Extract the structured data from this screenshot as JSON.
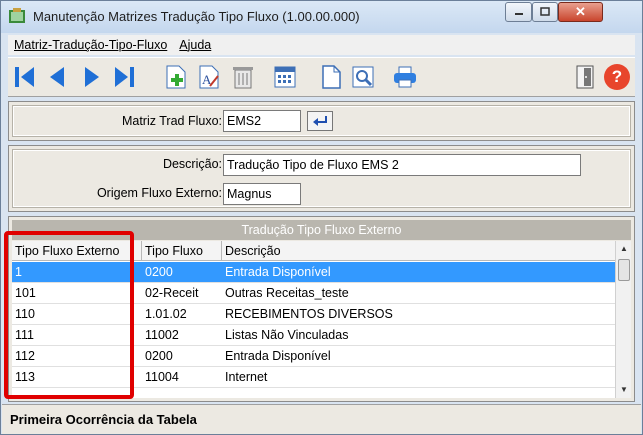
{
  "window": {
    "title": "Manutenção Matrizes Tradução Tipo Fluxo (1.00.00.000)",
    "close_glyph": "✕"
  },
  "menu": [
    {
      "label": "Matriz-Tradução-Tipo-Fluxo"
    },
    {
      "label": "Ajuda"
    }
  ],
  "toolbar": {
    "buttons": [
      "first-icon",
      "previous-icon",
      "next-icon",
      "last-icon",
      "add-icon",
      "edit-icon",
      "delete-icon",
      "calendar-icon",
      "document-icon",
      "preview-icon",
      "print-icon",
      "exit-door-icon",
      "help-icon"
    ],
    "help_glyph": "?"
  },
  "matriz": {
    "label": "Matriz Trad Fluxo:",
    "value": "EMS2"
  },
  "detail": {
    "descricao_label": "Descrição:",
    "descricao_value": "Tradução Tipo de Fluxo EMS 2",
    "origem_label": "Origem Fluxo Externo:",
    "origem_value": "Magnus"
  },
  "grid": {
    "title": "Tradução Tipo Fluxo Externo",
    "columns": [
      "Tipo Fluxo Externo",
      "Tipo Fluxo",
      "Descrição"
    ],
    "rows": [
      [
        "1",
        "0200",
        "Entrada Disponível"
      ],
      [
        "101",
        "02-Receit",
        "Outras Receitas_teste"
      ],
      [
        "110",
        "1.01.02",
        "RECEBIMENTOS DIVERSOS"
      ],
      [
        "111",
        "11002",
        "Listas Não Vinculadas"
      ],
      [
        "112",
        "0200",
        "Entrada Disponível"
      ],
      [
        "113",
        "11004",
        "Internet"
      ]
    ],
    "selected_row": 0
  },
  "status": {
    "text": "Primeira Ocorrência da Tabela"
  },
  "colors": {
    "accent": "#3399ff",
    "highlight": "#e00000"
  }
}
